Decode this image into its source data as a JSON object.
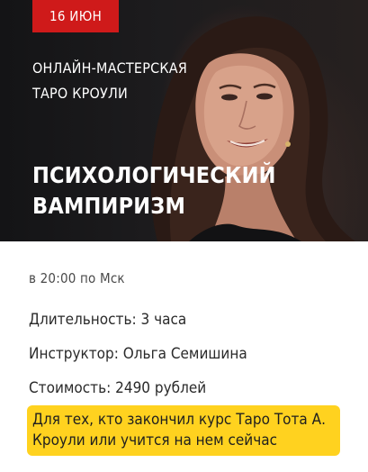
{
  "hero": {
    "date_badge": "16 ИЮН",
    "subtitle_line1": "ОНЛАЙН-МАСТЕРСКАЯ",
    "subtitle_line2": "ТАРО КРОУЛИ",
    "title_line1": "ПСИХОЛОГИЧЕСКИЙ",
    "title_line2": "ВАМПИРИЗМ",
    "accent_color": "#cf1a1a"
  },
  "details": {
    "time": "в 20:00 по Мск",
    "duration": "Длительность: 3 часа",
    "instructor": "Инструктор: Ольга Семишина",
    "price": "Стоимость: 2490 рублей",
    "note_line1": "Для тех, кто закончил курс Таро Тота А.",
    "note_line2": "Кроули или учится на нем сейчас",
    "note_color": "#ffd21f"
  }
}
